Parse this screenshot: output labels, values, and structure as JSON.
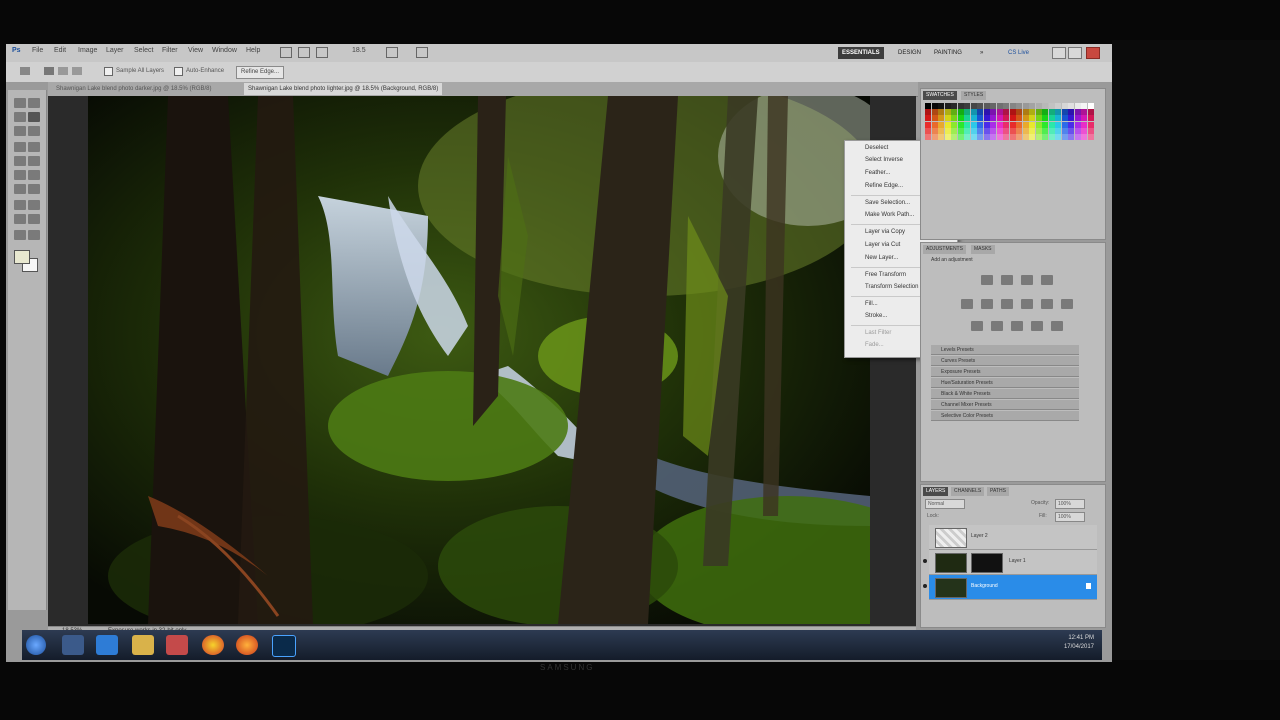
{
  "menubar": {
    "items": [
      "File",
      "Edit",
      "Image",
      "Layer",
      "Select",
      "Filter",
      "View",
      "Window",
      "Help"
    ],
    "zoom": "18.5",
    "workspaces": [
      "ESSENTIALS",
      "DESIGN",
      "PAINTING",
      "»"
    ],
    "cs_live": "CS Live"
  },
  "options_bar": {
    "sample_all_layers": "Sample All Layers",
    "auto_enhance": "Auto-Enhance",
    "refine_edge": "Refine Edge..."
  },
  "doc_tabs": [
    "Shawnigan Lake blend photo darker.jpg @ 18.5% (RGB/8)",
    "Shawnigan Lake blend photo lighter.jpg @ 18.5% (Background, RGB/8)"
  ],
  "status": {
    "zoom": "18.53%",
    "info": "Exposure works in 32-bit only"
  },
  "context_menu": {
    "items": [
      {
        "label": "Deselect",
        "disabled": false
      },
      {
        "label": "Select Inverse",
        "disabled": false
      },
      {
        "label": "Feather...",
        "disabled": false
      },
      {
        "label": "Refine Edge...",
        "disabled": false
      },
      {
        "label": "Save Selection...",
        "disabled": false
      },
      {
        "label": "Make Work Path...",
        "disabled": false
      },
      {
        "label": "Layer via Copy",
        "disabled": false
      },
      {
        "label": "Layer via Cut",
        "disabled": false
      },
      {
        "label": "New Layer...",
        "disabled": false
      },
      {
        "label": "Free Transform",
        "disabled": false
      },
      {
        "label": "Transform Selection",
        "disabled": false
      },
      {
        "label": "Fill...",
        "disabled": false
      },
      {
        "label": "Stroke...",
        "disabled": false
      },
      {
        "label": "Last Filter",
        "disabled": true
      },
      {
        "label": "Fade...",
        "disabled": true
      }
    ]
  },
  "swatches_panel": {
    "tabs": [
      "SWATCHES",
      "STYLES"
    ]
  },
  "adjustments_panel": {
    "tabs": [
      "ADJUSTMENTS",
      "MASKS"
    ],
    "title": "Add an adjustment",
    "presets": [
      "Levels Presets",
      "Curves Presets",
      "Exposure Presets",
      "Hue/Saturation Presets",
      "Black & White Presets",
      "Channel Mixer Presets",
      "Selective Color Presets"
    ]
  },
  "layers_panel": {
    "tabs": [
      "LAYERS",
      "CHANNELS",
      "PATHS"
    ],
    "blend_mode": "Normal",
    "opacity_label": "Opacity:",
    "opacity": "100%",
    "fill_label": "Fill:",
    "fill": "100%",
    "lock_label": "Lock:",
    "layers": [
      {
        "name": "Layer 2",
        "selected": false
      },
      {
        "name": "Layer 1",
        "selected": false
      },
      {
        "name": "Background",
        "selected": true
      }
    ]
  },
  "taskbar": {
    "time": "12:41 PM",
    "date": "17/04/2017"
  },
  "monitor": {
    "brand": "SAMSUNG"
  },
  "colors": {
    "selection_blue": "#2a8ce8",
    "workspace_dark": "#3d3d3d",
    "taskbar": "#1d2738"
  }
}
